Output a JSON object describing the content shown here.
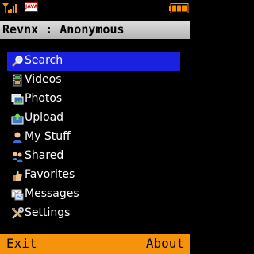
{
  "status": {
    "java_badge": "JAVA",
    "signal_icon": "signal-strength-icon",
    "battery_icon": "battery-icon"
  },
  "title": "Revnx : Anonymous",
  "menu": {
    "items": [
      {
        "label": "Search",
        "icon": "magnifier-icon",
        "selected": true
      },
      {
        "label": "Videos",
        "icon": "film-icon",
        "selected": false
      },
      {
        "label": "Photos",
        "icon": "photos-icon",
        "selected": false
      },
      {
        "label": "Upload",
        "icon": "upload-icon",
        "selected": false
      },
      {
        "label": "My Stuff",
        "icon": "user-icon",
        "selected": false
      },
      {
        "label": "Shared",
        "icon": "shared-users-icon",
        "selected": false
      },
      {
        "label": "Favorites",
        "icon": "thumbs-up-icon",
        "selected": false
      },
      {
        "label": "Messages",
        "icon": "messages-icon",
        "selected": false
      },
      {
        "label": "Settings",
        "icon": "tools-icon",
        "selected": false
      }
    ]
  },
  "softkeys": {
    "left": "Exit",
    "right": "About"
  },
  "colors": {
    "background": "#000000",
    "selection": "#1a22e0",
    "softkey_bar": "#f5930c",
    "battery": "#ff8a00"
  }
}
